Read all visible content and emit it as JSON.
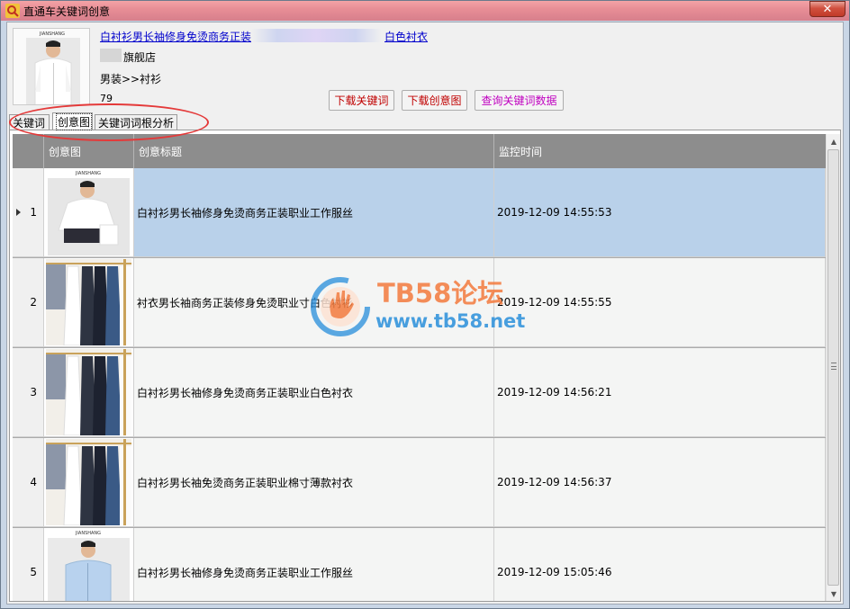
{
  "window": {
    "title": "直通车关键词创意",
    "close_label": "✕"
  },
  "product": {
    "title": "白衬衫男长袖修身免烫商务正装",
    "title_suffix": "白色衬衣",
    "shop_name": "旗舰店",
    "category": "男装>>衬衫",
    "count": "79",
    "brand_mark": "JIANSHANG"
  },
  "actions": {
    "download_keywords": "下载关键词",
    "download_creative": "下载创意图",
    "query_keyword_data": "查询关键词数据"
  },
  "tabs": [
    {
      "label": "关键词",
      "active": false
    },
    {
      "label": "创意图",
      "active": true
    },
    {
      "label": "关键词词根分析",
      "active": false
    }
  ],
  "grid": {
    "columns": [
      "创意图",
      "创意标题",
      "监控时间"
    ],
    "rows": [
      {
        "index": "1",
        "image": "man-white-shirt",
        "title": "白衬衫男长袖修身免烫商务正装职业工作服丝",
        "time": "2019-12-09 14:55:53",
        "selected": true
      },
      {
        "index": "2",
        "image": "shirts-on-rack",
        "title": "衬衣男长袖商务正装修身免烫职业寸白色衬衫",
        "time": "2019-12-09 14:55:55",
        "selected": false
      },
      {
        "index": "3",
        "image": "shirts-on-rack",
        "title": "白衬衫男长袖修身免烫商务正装职业白色衬衣",
        "time": "2019-12-09 14:56:21",
        "selected": false
      },
      {
        "index": "4",
        "image": "shirts-on-rack",
        "title": "白衬衫男长袖免烫商务正装职业棉寸薄款衬衣",
        "time": "2019-12-09 14:56:37",
        "selected": false
      },
      {
        "index": "5",
        "image": "man-blue-shirt",
        "title": "白衬衫男长袖修身免烫商务正装职业工作服丝",
        "time": "2019-12-09 15:05:46",
        "selected": false
      }
    ]
  },
  "watermark": {
    "line1": "TB58论坛",
    "line2": "www.tb58.net"
  },
  "colors": {
    "accent_red": "#c00000",
    "accent_magenta": "#c000c0",
    "selected_row": "#b9d1ea",
    "header_bg": "#8d8d8d",
    "highlight": "#e43a3a"
  }
}
